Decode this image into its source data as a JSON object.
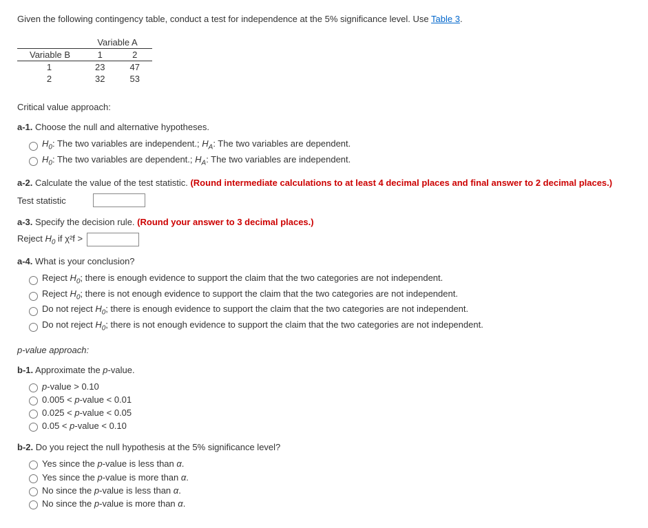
{
  "intro_text": "Given the following contingency table, conduct a test for independence at the 5% significance level. Use ",
  "table3_link": "Table 3",
  "intro_period": ".",
  "table": {
    "varA_label": "Variable A",
    "varB_label": "Variable B",
    "colA1": "1",
    "colA2": "2",
    "rowB1": "1",
    "rowB2": "2",
    "cell_11": "23",
    "cell_12": "47",
    "cell_21": "32",
    "cell_22": "53"
  },
  "cv_approach": "Critical value approach:",
  "a1": {
    "label_bold": "a-1.",
    "label_rest": " Choose the null and alternative hypotheses.",
    "opt1_h0": "H",
    "opt1_h0sub": "0",
    "opt1_h0text": ": The two variables are independent.; ",
    "opt1_ha": "H",
    "opt1_hasub": "A",
    "opt1_hatext": ": The two variables are dependent.",
    "opt2_h0": "H",
    "opt2_h0sub": "0",
    "opt2_h0text": ": The two variables are dependent.; ",
    "opt2_ha": "H",
    "opt2_hasub": "A",
    "opt2_hatext": ": The two variables are independent."
  },
  "a2": {
    "label_bold": "a-2.",
    "label_rest": " Calculate the value of the test statistic. ",
    "red": "(Round intermediate calculations to at least 4 decimal places and final answer to 2 decimal places.)",
    "input_label": "Test statistic"
  },
  "a3": {
    "label_bold": "a-3.",
    "label_rest": " Specify the decision rule. ",
    "red": "(Round your answer to 3 decimal places.)",
    "reject_prefix": "Reject ",
    "reject_h": "H",
    "reject_sub": "0",
    "reject_if": " if ",
    "chi": "χ²f",
    "gt": " > "
  },
  "a4": {
    "label_bold": "a-4.",
    "label_rest": " What is your conclusion?",
    "opt1_pre": "Reject ",
    "opt1_h": "H",
    "opt1_sub": "0",
    "opt1_post": "; there is enough evidence to support the claim that the two categories are not independent.",
    "opt2_pre": "Reject ",
    "opt2_h": "H",
    "opt2_sub": "0",
    "opt2_post": "; there is not enough evidence to support the claim that the two categories are not independent.",
    "opt3_pre": "Do not reject ",
    "opt3_h": "H",
    "opt3_sub": "0",
    "opt3_post": "; there is enough evidence to support the claim that the two categories are not independent.",
    "opt4_pre": "Do not reject ",
    "opt4_h": "H",
    "opt4_sub": "0",
    "opt4_post": "; there is not enough evidence to support the claim that the two categories are not independent."
  },
  "pv_approach": "p-value approach:",
  "b1": {
    "label_bold": "b-1.",
    "label_rest": " Approximate the ",
    "label_p": "p",
    "label_end": "-value.",
    "opt1_p": "p",
    "opt1_rest": "-value > 0.10",
    "opt2_pre": "0.005 < ",
    "opt2_p": "p",
    "opt2_rest": "-value < 0.01",
    "opt3_pre": "0.025 < ",
    "opt3_p": "p",
    "opt3_rest": "-value < 0.05",
    "opt4_pre": "0.05 < ",
    "opt4_p": "p",
    "opt4_rest": "-value < 0.10"
  },
  "b2": {
    "label_bold": "b-2.",
    "label_rest": " Do you reject the null hypothesis at the 5% significance level?",
    "opt1_pre": "Yes since the ",
    "opt1_p": "p",
    "opt1_mid": "-value is less than ",
    "opt1_a": "α",
    "opt1_end": ".",
    "opt2_pre": "Yes since the ",
    "opt2_p": "p",
    "opt2_mid": "-value is more than ",
    "opt2_a": "α",
    "opt2_end": ".",
    "opt3_pre": "No since the ",
    "opt3_p": "p",
    "opt3_mid": "-value is less than ",
    "opt3_a": "α",
    "opt3_end": ".",
    "opt4_pre": "No since the ",
    "opt4_p": "p",
    "opt4_mid": "-value is more than ",
    "opt4_a": "α",
    "opt4_end": "."
  }
}
